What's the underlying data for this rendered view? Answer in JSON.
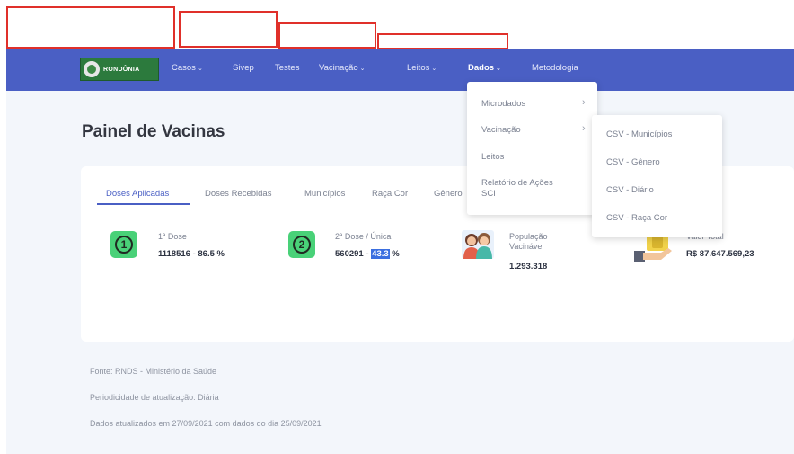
{
  "nav": {
    "logo_text": "RONDÔNIA",
    "items": [
      {
        "label": "Casos",
        "has_dropdown": true
      },
      {
        "label": "Sivep",
        "has_dropdown": false
      },
      {
        "label": "Testes",
        "has_dropdown": false
      },
      {
        "label": "Vacinação",
        "has_dropdown": true
      },
      {
        "label": "Leitos",
        "has_dropdown": true
      },
      {
        "label": "Dados",
        "has_dropdown": true,
        "active": true
      },
      {
        "label": "Metodologia",
        "has_dropdown": false
      }
    ],
    "chevron": "⌄"
  },
  "page": {
    "title": "Painel de Vacinas"
  },
  "tabs": [
    "Doses Aplicadas",
    "Doses Recebidas",
    "Municípios",
    "Raça Cor",
    "Gênero"
  ],
  "stats": [
    {
      "icon": "number-one-icon",
      "badge": "1",
      "label": "1ª Dose",
      "value": "1118516 - 86.5 %"
    },
    {
      "icon": "number-two-icon",
      "badge": "2",
      "label": "2ª Dose / Única",
      "value_prefix": "560291 - ",
      "value_highlight": "43.3",
      "value_suffix": " %"
    },
    {
      "icon": "population-icon",
      "label_line1": "População",
      "label_line2": "Vacinável",
      "value": "1.293.318"
    },
    {
      "icon": "money-icon",
      "label": "Valor Total",
      "value": "R$ 87.647.569,23"
    }
  ],
  "footer": {
    "source": "Fonte: RNDS - Ministério da Saúde",
    "frequency": "Periodicidade de atualização: Diária",
    "updated": "Dados atualizados em 27/09/2021 com dados do dia 25/09/2021"
  },
  "dados_menu": {
    "items": [
      {
        "label": "Microdados",
        "submenu": true
      },
      {
        "label": "Vacinação",
        "submenu": true
      },
      {
        "label": "Leitos",
        "submenu": false
      },
      {
        "label_line1": "Relatório de Ações",
        "label_line2": "SCI",
        "submenu": false
      }
    ],
    "submenu_chevron": "›"
  },
  "vacinacao_submenu": {
    "items": [
      "CSV - Municípios",
      "CSV - Gênero",
      "CSV - Diário",
      "CSV - Raça Cor"
    ]
  },
  "colors": {
    "navbar": "#4a5fc4",
    "accent": "#4a5fc4",
    "dose_badge": "#49d178",
    "annotation_box": "#e0302a",
    "highlight": "#3b6fe0"
  }
}
